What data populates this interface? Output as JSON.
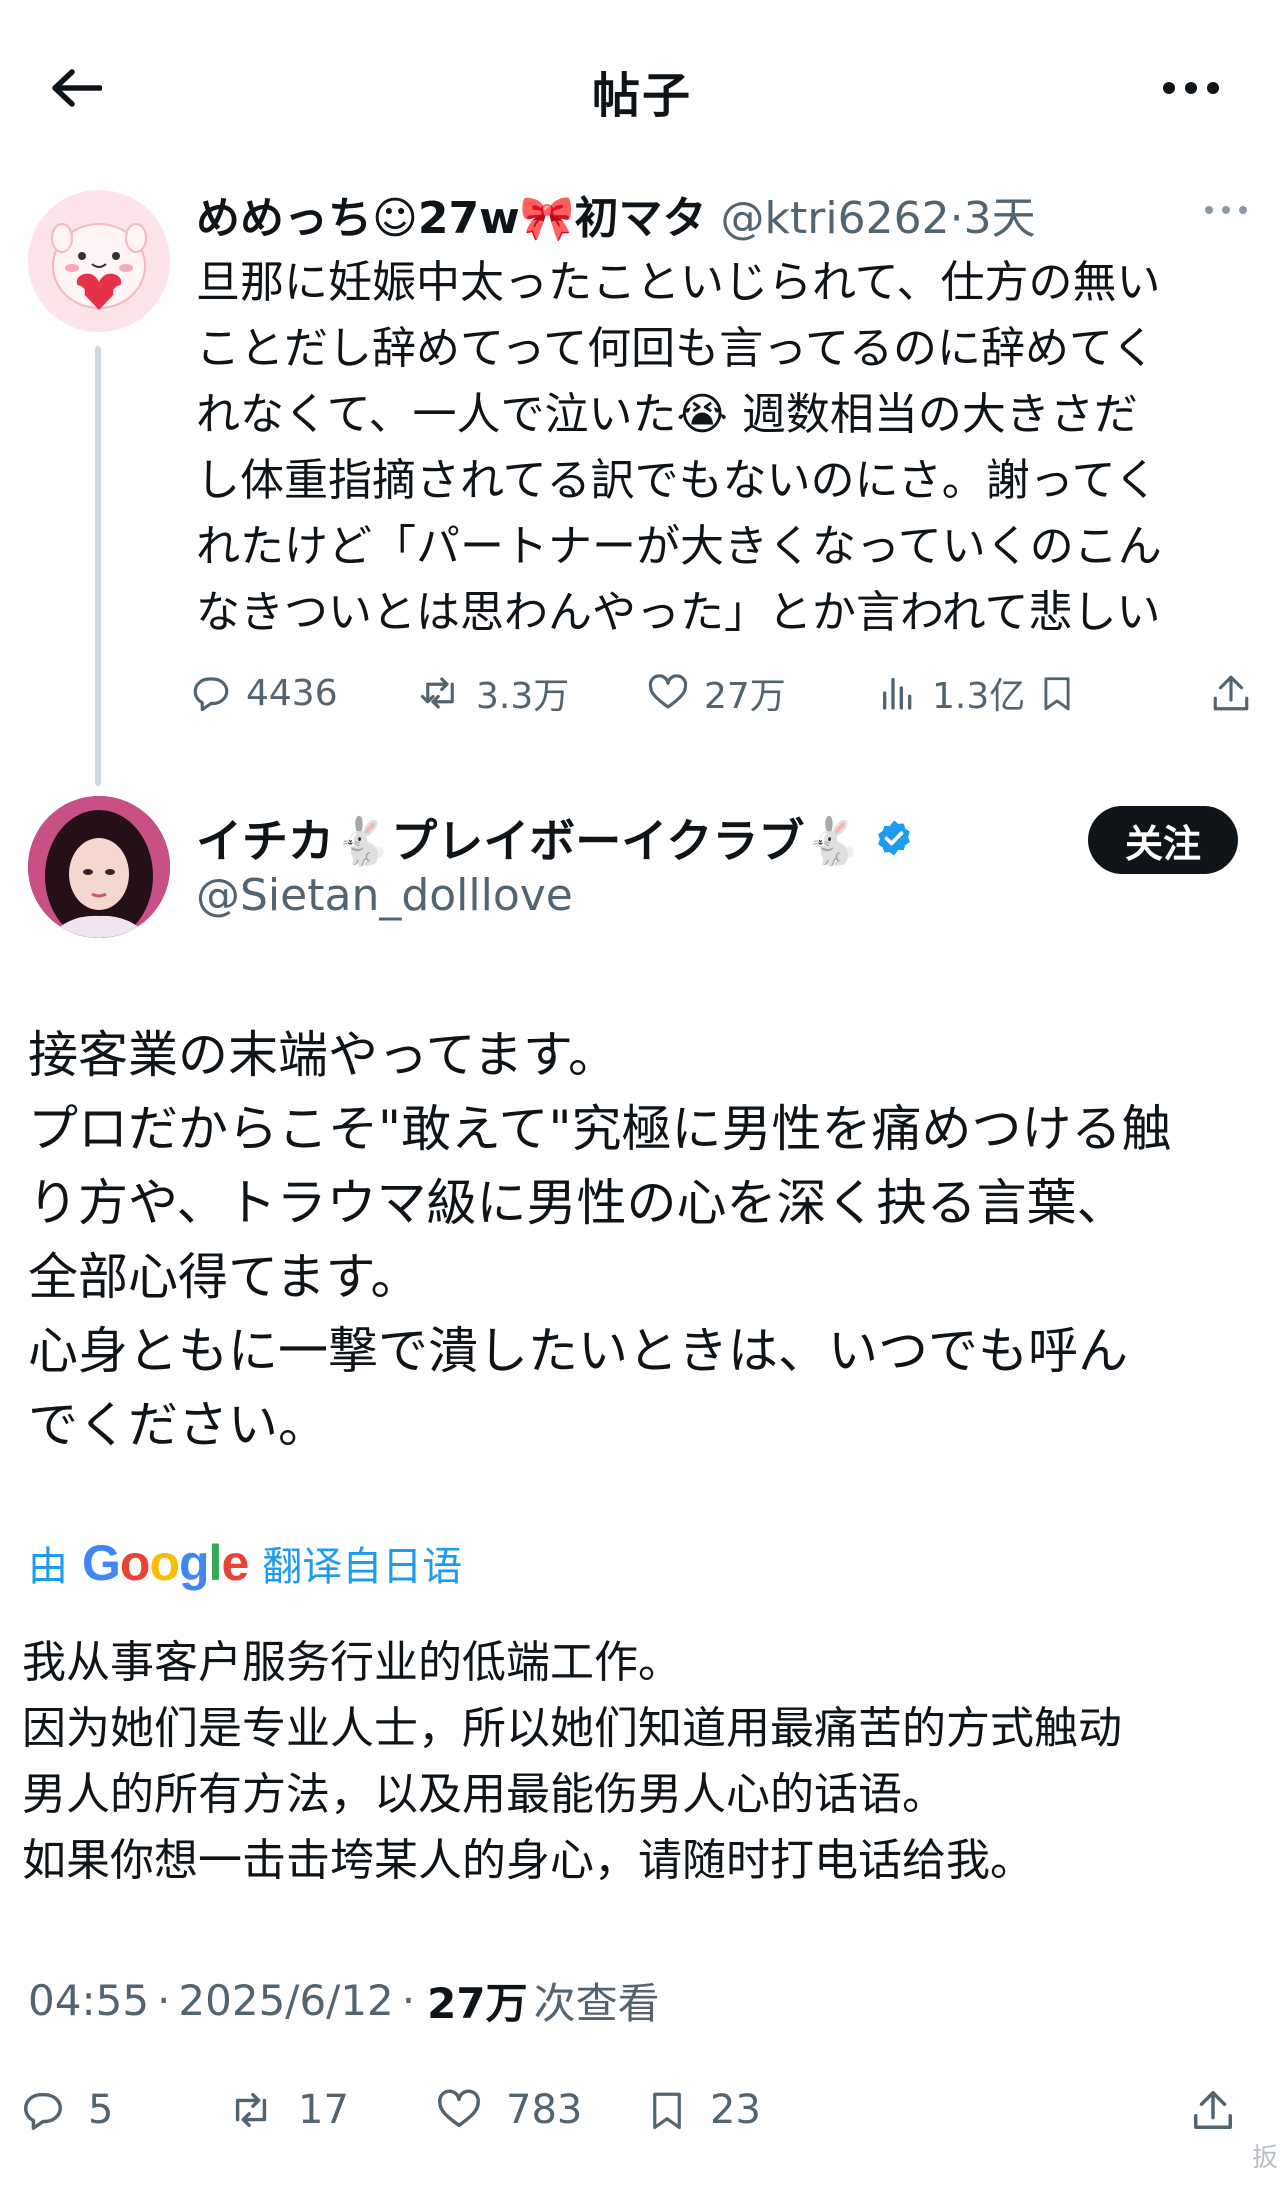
{
  "header": {
    "title": "帖子"
  },
  "parent_tweet": {
    "display_name": "めめっち☺27w🎀初マタ",
    "handle": "@ktri6262",
    "separator": "·",
    "time": "3天",
    "text_lines": [
      "旦那に妊娠中太ったこといじられて、仕方の無い",
      "ことだし辞めてって何回も言ってるのに辞めてく",
      "れなくて、一人で泣いた😭 週数相当の大きさだ",
      "し体重指摘されてる訳でもないのにさ。謝ってく",
      "れたけど「パートナーが大きくなっていくのこん",
      "なきついとは思わんやった」とか言われて悲しい"
    ],
    "stats": {
      "replies": "4436",
      "reposts": "3.3万",
      "likes": "27万",
      "views": "1.3亿"
    }
  },
  "main_tweet": {
    "display_name": "イチカ🐇プレイボーイクラブ🐇",
    "handle": "@Sietan_dolllove",
    "follow_label": "关注",
    "text_lines": [
      "接客業の末端やってます。",
      "プロだからこそ\"敢えて\"究極に男性を痛めつける触",
      "り方や、トラウマ級に男性の心を深く抉る言葉、",
      "全部心得てます。",
      "心身ともに一撃で潰したいときは、いつでも呼ん",
      "でください。"
    ],
    "translate": {
      "prefix": "由",
      "brand": "Google",
      "suffix": "翻译自日语"
    },
    "translated_lines": [
      "我从事客户服务行业的低端工作。",
      "因为她们是专业人士，所以她们知道用最痛苦的方式触动",
      "男人的所有方法，以及用最能伤男人心的话语。",
      "如果你想一击击垮某人的身心，请随时打电话给我。"
    ],
    "time": "04:55",
    "date": "2025/6/12",
    "views": "27万",
    "views_label": "次查看",
    "stats": {
      "replies": "5",
      "reposts": "17",
      "likes": "783",
      "bookmarks": "23"
    }
  },
  "watermark": "扳",
  "colors": {
    "text": "#0f1419",
    "muted": "#536471",
    "link": "#1d9bf0",
    "verified": "#1d9bf0"
  }
}
